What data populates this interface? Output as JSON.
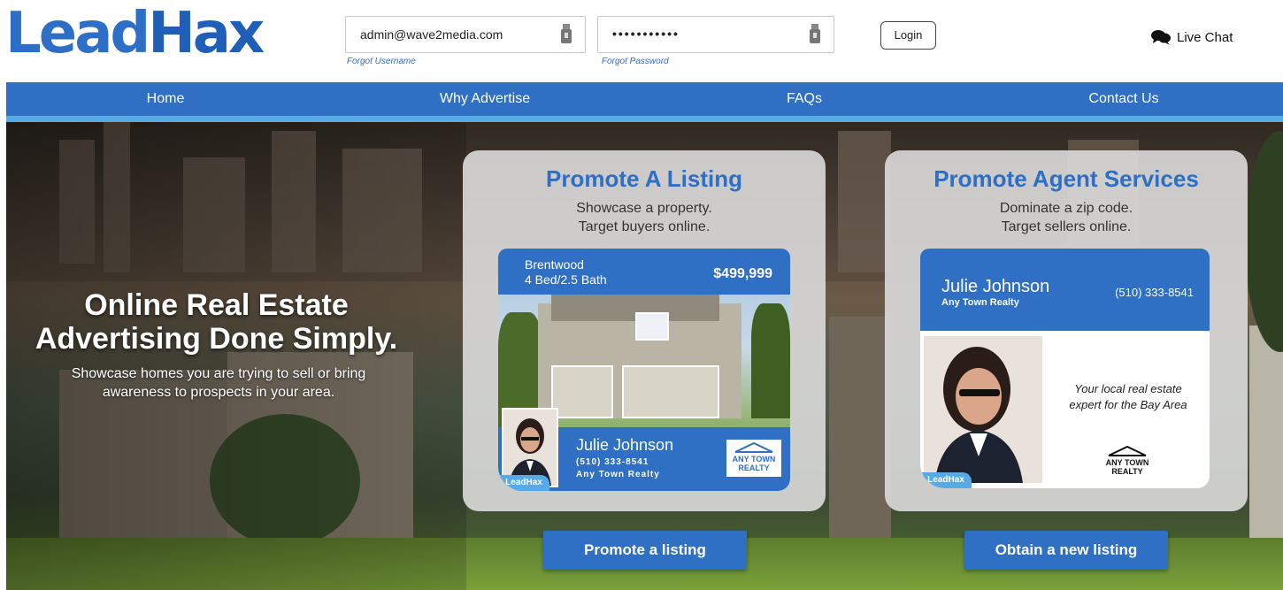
{
  "brand": {
    "logo_part1": "Lead",
    "logo_part2": "Hax"
  },
  "login": {
    "username_value": "admin@wave2media.com",
    "password_value": "•••••••••••",
    "forgot_username": "Forgot Username",
    "forgot_password": "Forgot Password",
    "login_label": "Login"
  },
  "livechat": {
    "label": "Live Chat"
  },
  "nav": {
    "items": [
      {
        "label": "Home"
      },
      {
        "label": "Why Advertise"
      },
      {
        "label": "FAQs"
      },
      {
        "label": "Contact Us"
      }
    ]
  },
  "hero": {
    "title_line1": "Online Real Estate",
    "title_line2": "Advertising Done Simply.",
    "subtitle_line1": "Showcase homes you are trying to sell or bring",
    "subtitle_line2": "awareness to prospects in your area."
  },
  "panels": [
    {
      "title": "Promote A Listing",
      "sub_line1": "Showcase a property.",
      "sub_line2": "Target buyers online.",
      "button": "Promote a listing",
      "card": {
        "location": "Brentwood",
        "details": "4 Bed/2.5 Bath",
        "price": "$499,999",
        "agent_name": "Julie Johnson",
        "agent_phone": "(510) 333-8541",
        "agent_realty": "Any Town Realty",
        "brand_tag": "LeadHax",
        "logo_text1": "ANY TOWN",
        "logo_text2": "REALTY"
      }
    },
    {
      "title": "Promote Agent Services",
      "sub_line1": "Dominate a zip code.",
      "sub_line2": "Target sellers online.",
      "button": "Obtain a new listing",
      "card": {
        "agent_name": "Julie Johnson",
        "agent_realty": "Any Town Realty",
        "agent_phone": "(510) 333-8541",
        "tagline_line1": "Your local real estate",
        "tagline_line2": "expert for the Bay Area",
        "brand_tag": "LeadHax",
        "logo_text1": "ANY TOWN",
        "logo_text2": "REALTY"
      }
    }
  ],
  "colors": {
    "primary_blue": "#2f6fc4",
    "light_blue": "#58aae6",
    "white": "#ffffff"
  }
}
